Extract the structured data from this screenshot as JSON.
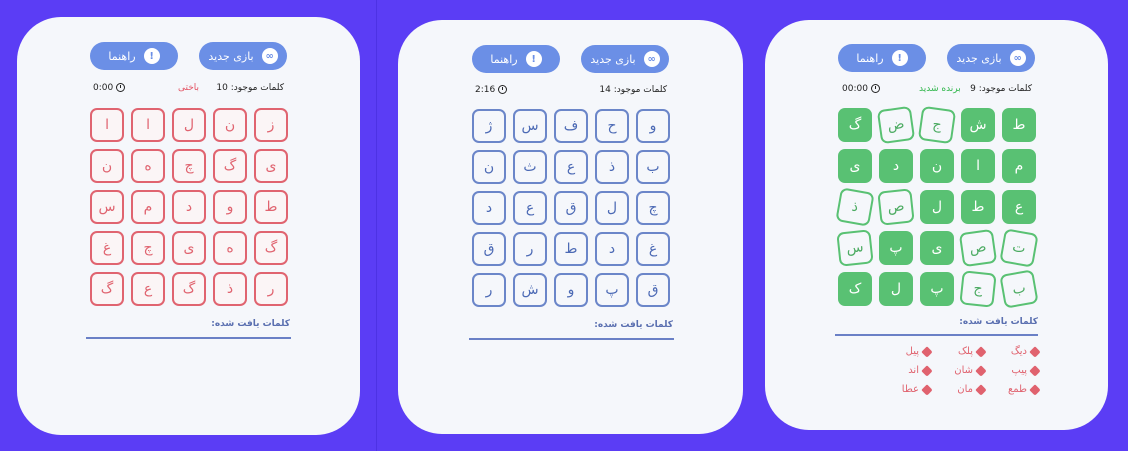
{
  "panels": [
    {
      "new_game_label": "بازی جدید",
      "help_label": "راهنما",
      "words_available_label": "کلمات موجود:",
      "words_available_count": "10",
      "status_text": "باختی",
      "timer": "0:00",
      "found_words_label": "کلمات یافت شده:",
      "grid": [
        [
          "ز",
          "ن",
          "ل",
          "ا",
          "ا"
        ],
        [
          "ی",
          "گ",
          "چ",
          "ه",
          "ن"
        ],
        [
          "ط",
          "و",
          "د",
          "م",
          "س"
        ],
        [
          "گ",
          "ه",
          "ی",
          "چ",
          "غ"
        ],
        [
          "ر",
          "ذ",
          "گ",
          "ع",
          "گ"
        ]
      ],
      "found_words": []
    },
    {
      "new_game_label": "بازی جدید",
      "help_label": "راهنما",
      "words_available_label": "کلمات موجود:",
      "words_available_count": "14",
      "status_text": "",
      "timer": "2:16",
      "found_words_label": "کلمات یافت شده:",
      "grid": [
        [
          "و",
          "ح",
          "ف",
          "س",
          "ژ"
        ],
        [
          "ب",
          "ذ",
          "ع",
          "ث",
          "ن"
        ],
        [
          "چ",
          "ل",
          "ق",
          "ع",
          "د"
        ],
        [
          "غ",
          "د",
          "ط",
          "ر",
          "ق"
        ],
        [
          "ق",
          "پ",
          "و",
          "ش",
          "ر"
        ]
      ],
      "found_words": []
    },
    {
      "new_game_label": "بازی جدید",
      "help_label": "راهنما",
      "words_available_label": "کلمات موجود:",
      "words_available_count": "9",
      "status_text": "برنده شدید",
      "timer": "00:00",
      "found_words_label": "کلمات یافت شده:",
      "grid": [
        [
          "ط",
          "ش",
          "ج",
          "ض",
          "گ"
        ],
        [
          "م",
          "ا",
          "ن",
          "د",
          "ی"
        ],
        [
          "ع",
          "ط",
          "ل",
          "ص",
          "ذ"
        ],
        [
          "ت",
          "ص",
          "ی",
          "پ",
          "س"
        ],
        [
          "ب",
          "ج",
          "پ",
          "ل",
          "ک"
        ]
      ],
      "found_words": [
        "دیگ",
        "پلک",
        "پیل",
        "پیپ",
        "شان",
        "اند",
        "طمع",
        "مان",
        "عطا"
      ]
    }
  ],
  "colors": {
    "background": "#5b3df5",
    "card": "#f5f7fb",
    "button": "#6b8fe6",
    "lose": "#e35161",
    "win": "#2fb64a",
    "tile_green": "#59c173"
  },
  "icons": {
    "new_game": "gamepad-icon",
    "help": "exclamation-icon",
    "timer": "clock-icon",
    "found_word": "tag-icon"
  }
}
